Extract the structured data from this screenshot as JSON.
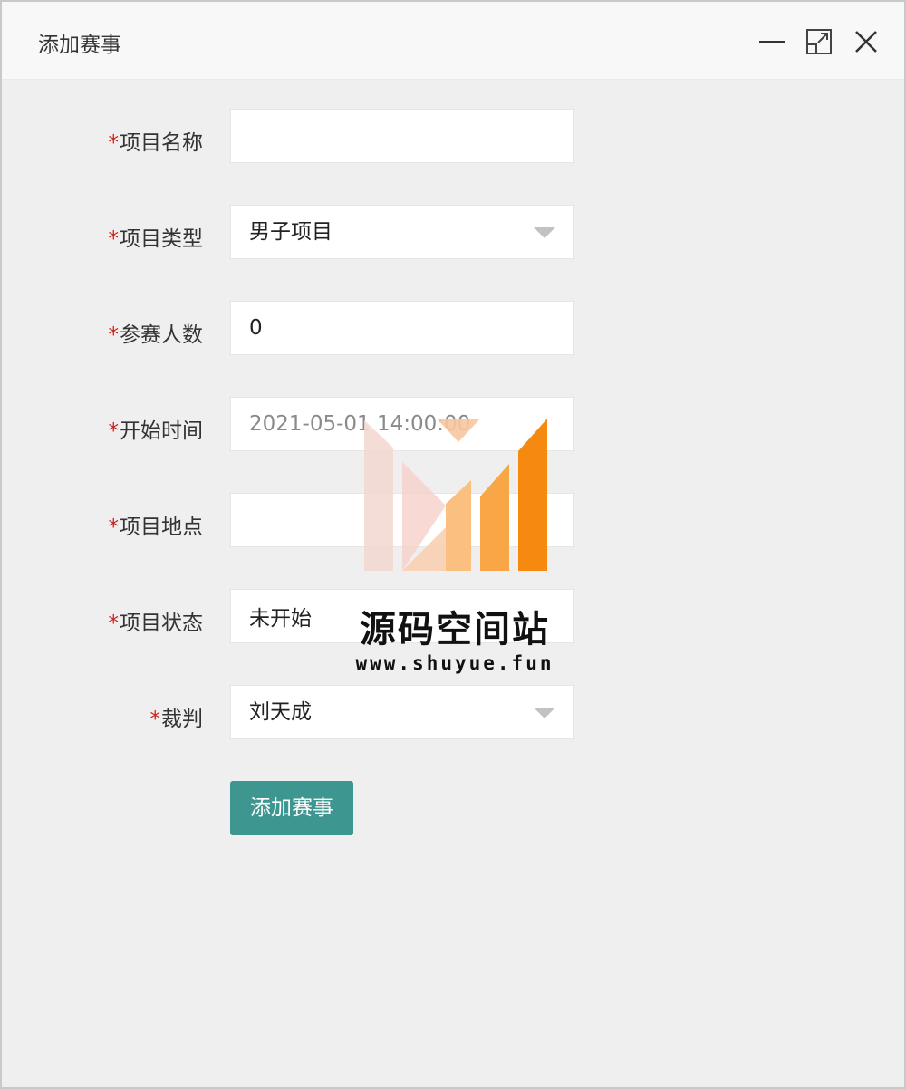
{
  "window": {
    "title": "添加赛事",
    "controls": [
      "minimize-icon",
      "maximize-icon",
      "close-icon"
    ]
  },
  "form": {
    "required_mark": "*",
    "fields": [
      {
        "label": "项目名称",
        "value": ""
      },
      {
        "label": "项目类型",
        "value": "男子项目",
        "type": "select"
      },
      {
        "label": "参赛人数",
        "value": "0"
      },
      {
        "label": "开始时间",
        "value": "2021-05-01 14:00:00"
      },
      {
        "label": "项目地点",
        "value": ""
      },
      {
        "label": "项目状态",
        "value": "未开始"
      },
      {
        "label": "裁判",
        "value": "刘天成",
        "type": "select"
      }
    ],
    "submit_label": "添加赛事"
  },
  "watermark": {
    "name": "源码空间站",
    "url": "www.shuyue.fun"
  },
  "colors": {
    "accent": "#3e9690",
    "required": "#d0211c",
    "background": "#efefef"
  }
}
